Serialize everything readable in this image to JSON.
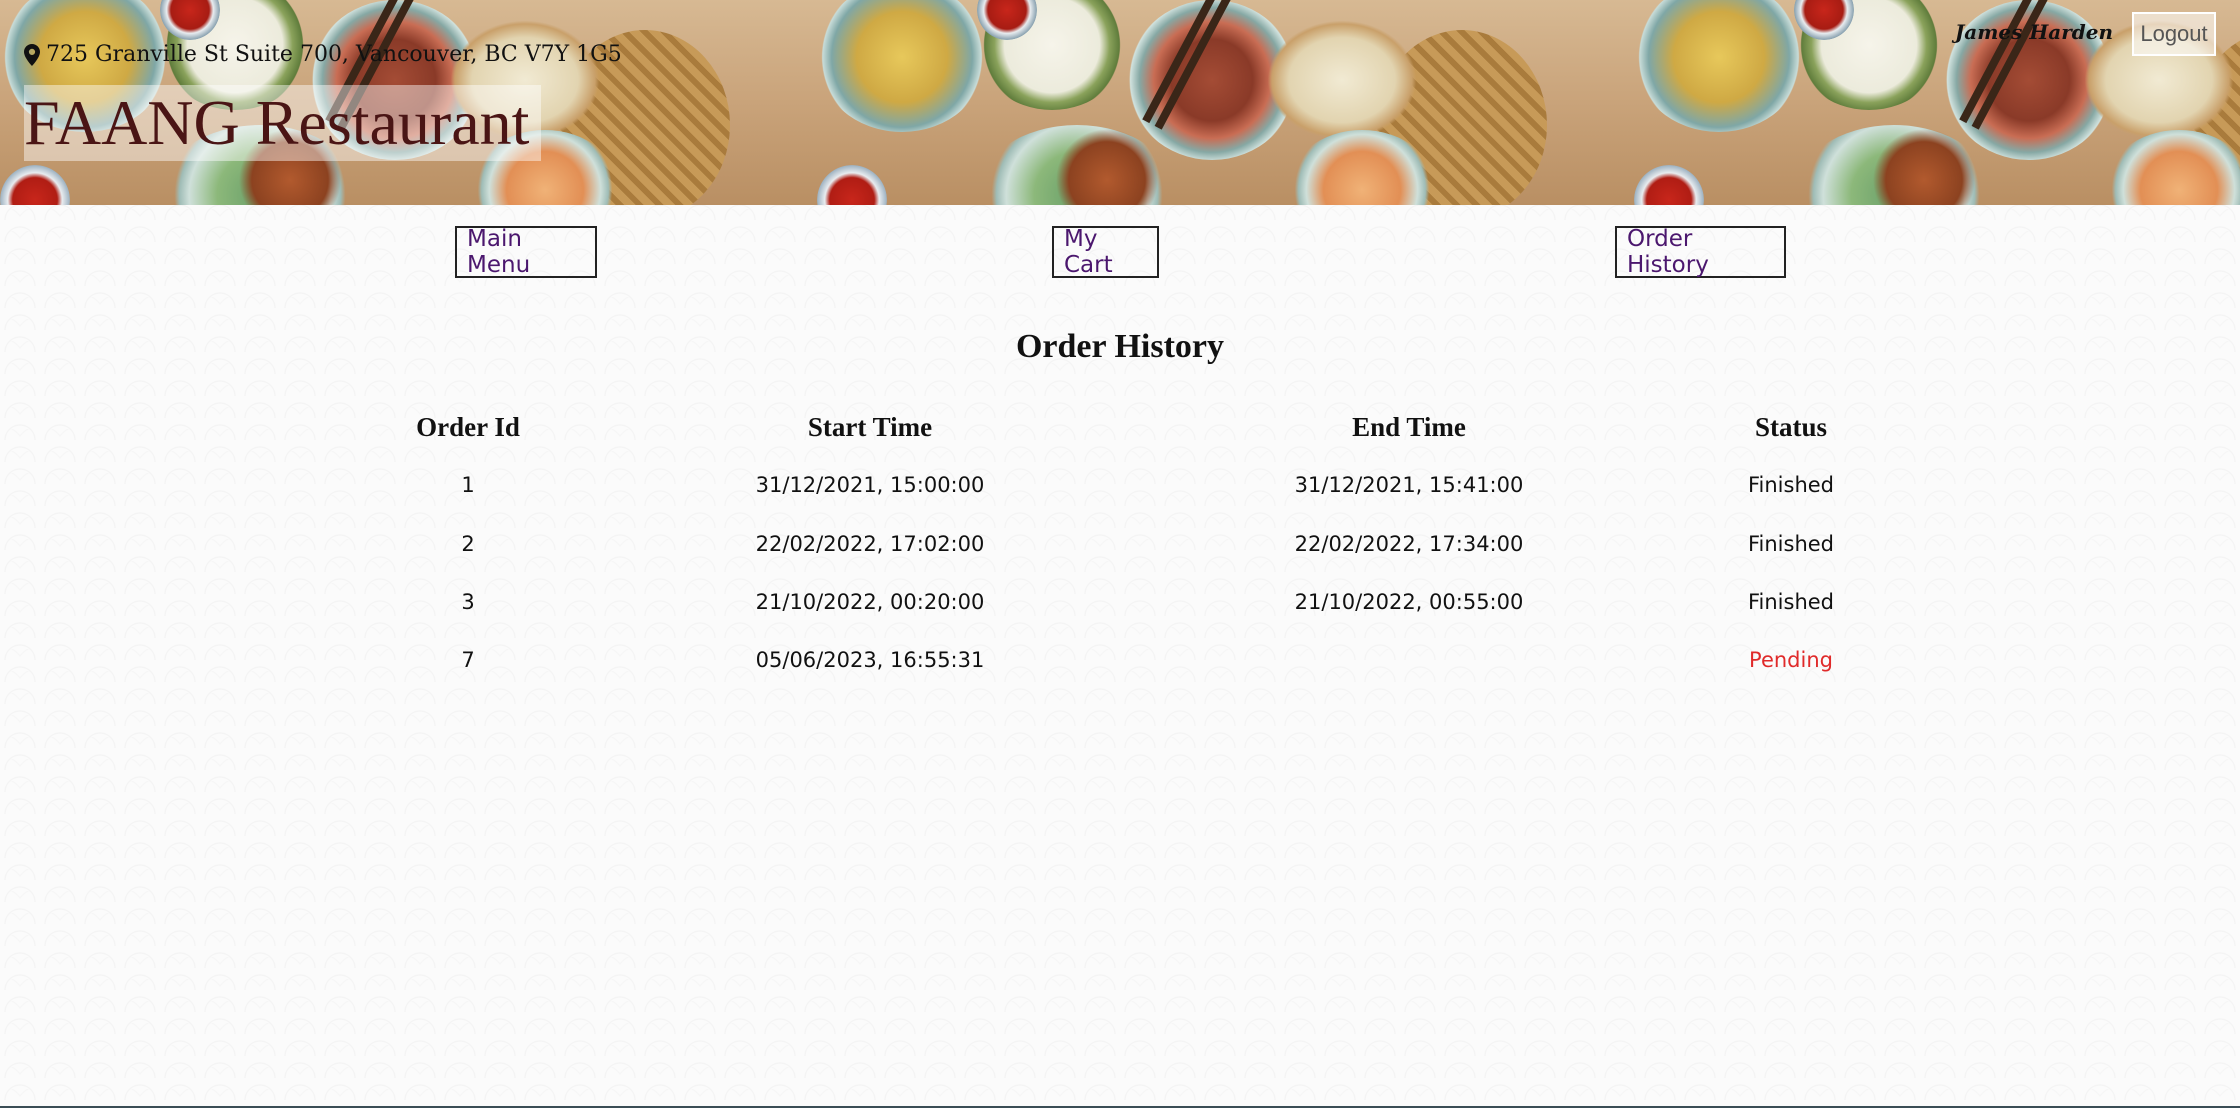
{
  "header": {
    "address": "725 Granville St Suite 700, Vancouver, BC V7Y 1G5",
    "restaurant_name": "FAANG Restaurant",
    "user_name": "James Harden",
    "logout_label": "Logout",
    "pin_icon": "location-pin-icon"
  },
  "nav": {
    "main_menu": "Main Menu",
    "my_cart": "My Cart",
    "order_history": "Order History",
    "link_color": "#4b176e"
  },
  "page": {
    "title": "Order History"
  },
  "table": {
    "columns": [
      "Order Id",
      "Start Time",
      "End Time",
      "Status"
    ],
    "rows": [
      {
        "order_id": "1",
        "start_time": "31/12/2021, 15:00:00",
        "end_time": "31/12/2021, 15:41:00",
        "status": "Finished"
      },
      {
        "order_id": "2",
        "start_time": "22/02/2022, 17:02:00",
        "end_time": "22/02/2022, 17:34:00",
        "status": "Finished"
      },
      {
        "order_id": "3",
        "start_time": "21/10/2022, 00:20:00",
        "end_time": "21/10/2022, 00:55:00",
        "status": "Finished"
      },
      {
        "order_id": "7",
        "start_time": "05/06/2023, 16:55:31",
        "end_time": "",
        "status": "Pending"
      }
    ],
    "status_colors": {
      "Finished": "#111111",
      "Pending": "#e02a2a"
    }
  }
}
